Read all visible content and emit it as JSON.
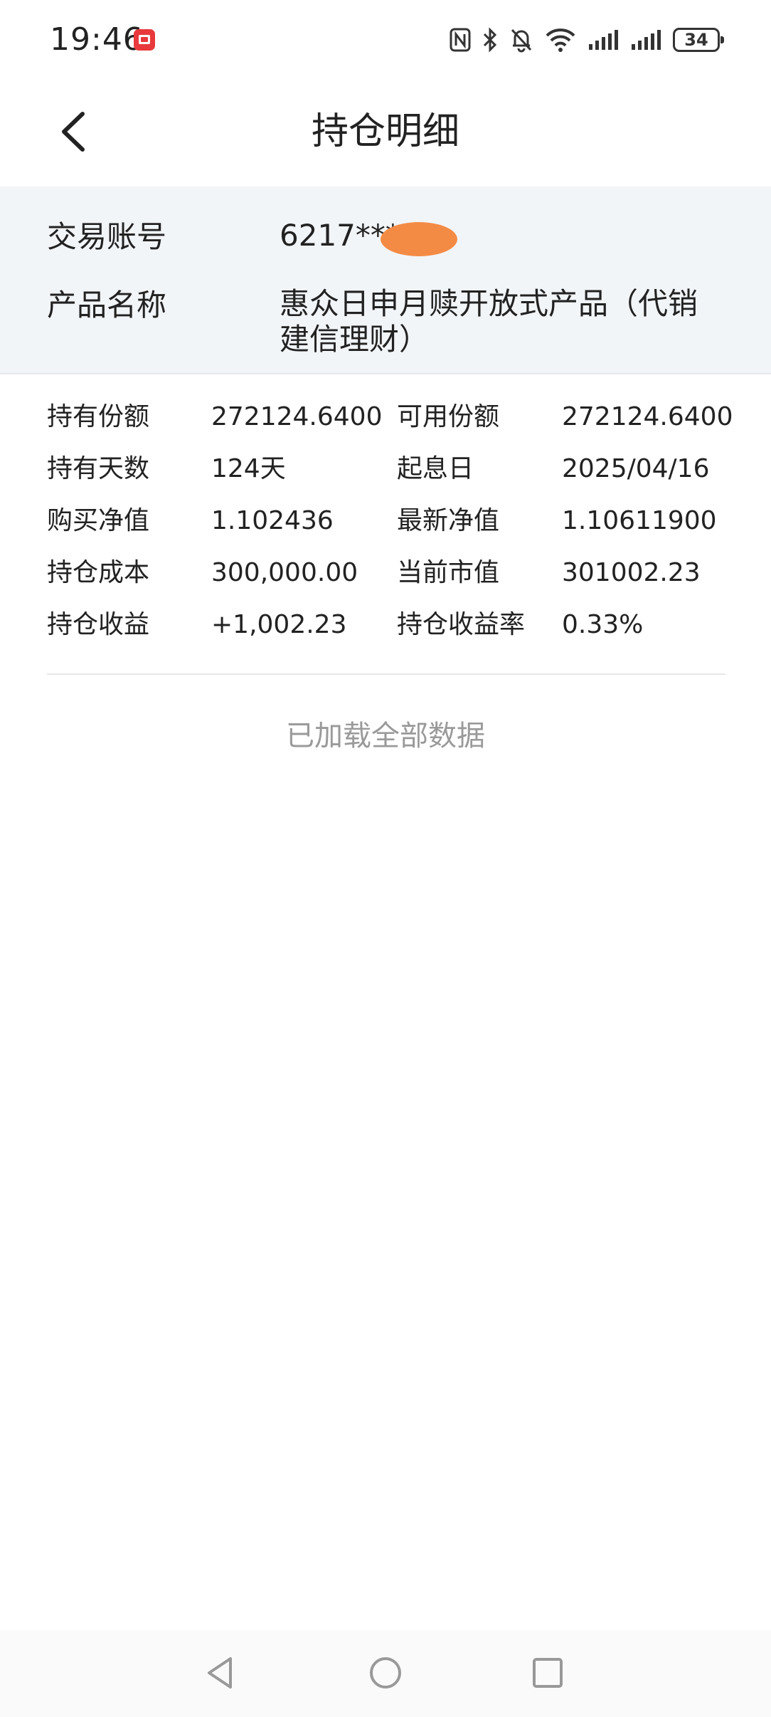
{
  "status_bar": {
    "time": "19:46",
    "battery_level": "34"
  },
  "header": {
    "title": "持仓明细"
  },
  "account_info": {
    "account_label": "交易账号",
    "account_value": "6217***",
    "product_label": "产品名称",
    "product_value": "惠众日申月赎开放式产品（代销建信理财）"
  },
  "holdings": {
    "rows": [
      {
        "label1": "持有份额",
        "value1": "272124.6400",
        "label2": "可用份额",
        "value2": "272124.6400"
      },
      {
        "label1": "持有天数",
        "value1": "124天",
        "label2": "起息日",
        "value2": "2025/04/16"
      },
      {
        "label1": "购买净值",
        "value1": "1.102436",
        "label2": "最新净值",
        "value2": "1.10611900"
      },
      {
        "label1": "持仓成本",
        "value1": "300,000.00",
        "label2": "当前市值",
        "value2": "301002.23"
      },
      {
        "label1": "持仓收益",
        "value1": "+1,002.23",
        "label2": "持仓收益率",
        "value2": "0.33%"
      }
    ]
  },
  "footer": {
    "loaded_text": "已加载全部数据"
  },
  "icons": {
    "app_notification": "red-app-icon",
    "nfc": "nfc-icon",
    "bluetooth": "bluetooth-icon",
    "mute": "bell-off-icon",
    "wifi": "wifi-icon",
    "signal": "signal-icon",
    "back": "chevron-left-icon"
  },
  "colors": {
    "panel_bg": "#f2f5f8",
    "redaction": "#f48b45",
    "muted_text": "#9a9a9a",
    "app_icon": "#e8393c"
  }
}
